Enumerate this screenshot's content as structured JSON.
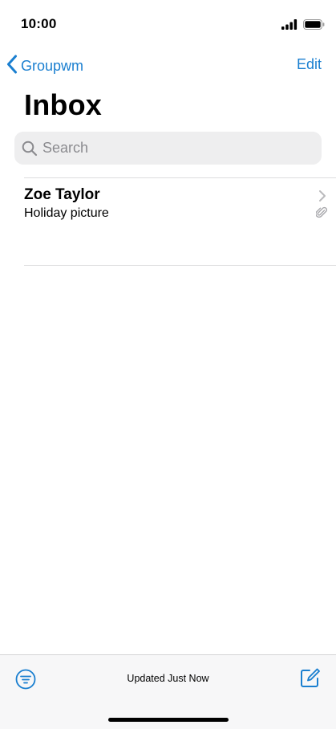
{
  "status_bar": {
    "time": "10:00"
  },
  "nav": {
    "back_label": "Groupwm",
    "edit_label": "Edit"
  },
  "page": {
    "title": "Inbox"
  },
  "search": {
    "placeholder": "Search",
    "value": ""
  },
  "messages": [
    {
      "sender": "Zoe Taylor",
      "subject": "Holiday picture",
      "has_attachment": true
    }
  ],
  "toolbar": {
    "status_text": "Updated Just Now"
  },
  "icons": {
    "back": "chevron-left-icon",
    "search": "magnifying-glass-icon",
    "chevron": "chevron-right-icon",
    "attachment": "paperclip-icon",
    "filter": "filter-icon",
    "compose": "compose-icon",
    "signal": "cellular-signal-icon",
    "battery": "battery-icon"
  },
  "colors": {
    "accent": "#1a7fd0",
    "search_bg": "#eeeeef",
    "toolbar_bg": "#f7f7f8",
    "secondary_text": "#8b8b8f"
  }
}
